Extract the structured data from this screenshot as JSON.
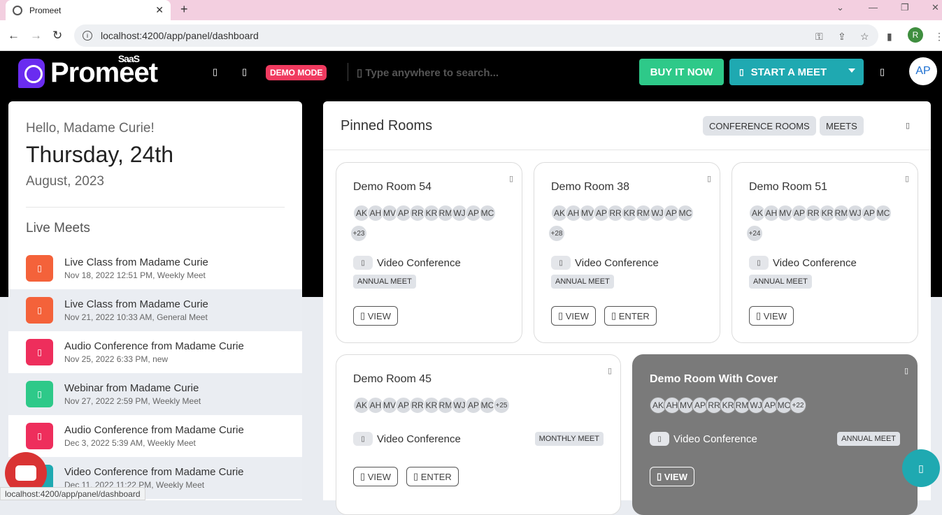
{
  "browser": {
    "tab_title": "Promeet",
    "tab_close": "✕",
    "new_tab": "+",
    "url": "localhost:4200/app/panel/dashboard",
    "profile_initial": "R",
    "status_url": "localhost:4200/app/panel/dashboard"
  },
  "header": {
    "logo": "Promeet",
    "logo_badge": "SaaS",
    "demo_mode": "DEMO MODE",
    "search_placeholder": "Type anywhere to search...",
    "buy_label": "BUY IT NOW",
    "start_label": "START A MEET",
    "avatar": "AP"
  },
  "welcome": {
    "greeting": "Hello, Madame Curie!",
    "day": "Thursday, 24th",
    "month": "August, 2023"
  },
  "live_meets": {
    "title": "Live Meets",
    "items": [
      {
        "title": "Live Class from Madame Curie",
        "sub": "Nov 18, 2022 12:51 PM, Weekly Meet",
        "color": "#f4623a"
      },
      {
        "title": "Live Class from Madame Curie",
        "sub": "Nov 21, 2022 10:33 AM, General Meet",
        "color": "#f4623a"
      },
      {
        "title": "Audio Conference from Madame Curie",
        "sub": "Nov 25, 2022 6:33 PM, new",
        "color": "#ee2e5c"
      },
      {
        "title": "Webinar from Madame Curie",
        "sub": "Nov 27, 2022 2:59 PM, Weekly Meet",
        "color": "#2ec989"
      },
      {
        "title": "Audio Conference from Madame Curie",
        "sub": "Dec 3, 2022 5:39 AM, Weekly Meet",
        "color": "#ee2e5c"
      },
      {
        "title": "Video Conference from Madame Curie",
        "sub": "Dec 11, 2022 11:22 PM, Weekly Meet",
        "color": "#1fa9b1"
      }
    ]
  },
  "pinned": {
    "title": "Pinned Rooms",
    "filters": [
      "CONFERENCE ROOMS",
      "MEETS"
    ],
    "avatars": [
      "AK",
      "AH",
      "MV",
      "AP",
      "RR",
      "KR",
      "RM",
      "WJ",
      "AP",
      "MC"
    ],
    "video_label": "Video Conference",
    "view_label": "VIEW",
    "enter_label": "ENTER",
    "rooms": [
      {
        "name": "Demo Room 54",
        "more": "+23",
        "tag": "ANNUAL MEET"
      },
      {
        "name": "Demo Room 38",
        "more": "+28",
        "tag": "ANNUAL MEET"
      },
      {
        "name": "Demo Room 51",
        "more": "+24",
        "tag": "ANNUAL MEET"
      },
      {
        "name": "Demo Room 45",
        "more": "+25",
        "tag": "MONTHLY MEET"
      },
      {
        "name": "Demo Room With Cover",
        "more": "+22",
        "tag": "ANNUAL MEET"
      }
    ]
  }
}
